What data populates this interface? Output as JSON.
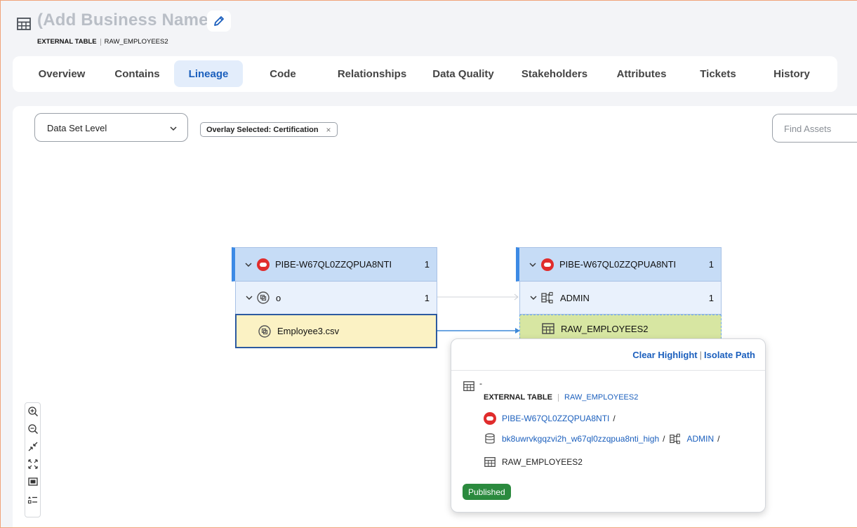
{
  "header": {
    "title": "(Add Business Name)",
    "type_label": "EXTERNAL TABLE",
    "asset_name": "RAW_EMPLOYEES2"
  },
  "tabs": [
    {
      "label": "Overview",
      "active": false
    },
    {
      "label": "Contains",
      "active": false
    },
    {
      "label": "Lineage",
      "active": true
    },
    {
      "label": "Code",
      "active": false
    },
    {
      "label": "Relationships",
      "active": false
    },
    {
      "label": "Data Quality",
      "active": false
    },
    {
      "label": "Stakeholders",
      "active": false
    },
    {
      "label": "Attributes",
      "active": false
    },
    {
      "label": "Tickets",
      "active": false
    },
    {
      "label": "History",
      "active": false
    }
  ],
  "toolbar": {
    "level_value": "Data Set Level",
    "overlay_chip": "Overlay Selected: Certification",
    "find_placeholder": "Find Assets"
  },
  "lineage": {
    "source": {
      "db": {
        "label": "PIBE-W67QL0ZZQPUA8NTI",
        "count": "1"
      },
      "schema": {
        "label": "o",
        "count": "1"
      },
      "file": {
        "label": "Employee3.csv"
      }
    },
    "target": {
      "db": {
        "label": "PIBE-W67QL0ZZQPUA8NTI",
        "count": "1"
      },
      "schema": {
        "label": "ADMIN",
        "count": "1"
      },
      "table": {
        "label": "RAW_EMPLOYEES2"
      }
    }
  },
  "popup": {
    "clear_highlight": "Clear Highlight",
    "isolate_path": "Isolate Path",
    "name": "-",
    "type_label": "EXTERNAL TABLE",
    "asset_link": "RAW_EMPLOYEES2",
    "path_db": "PIBE-W67QL0ZZQPUA8NTI",
    "path_sep": "/",
    "path_database": "bk8uwrvkgqzvi2h_w67ql0zzqpua8nti_high",
    "path_schema": "ADMIN",
    "path_table": "RAW_EMPLOYEES2",
    "status": "Published"
  },
  "colors": {
    "accent": "#1b5fbd",
    "db_node": "#c6dcf6",
    "selected_node": "#fbf2c4",
    "target_node": "#d7e6a2",
    "published": "#2b8a3e",
    "oracle_red": "#e02c2c"
  }
}
